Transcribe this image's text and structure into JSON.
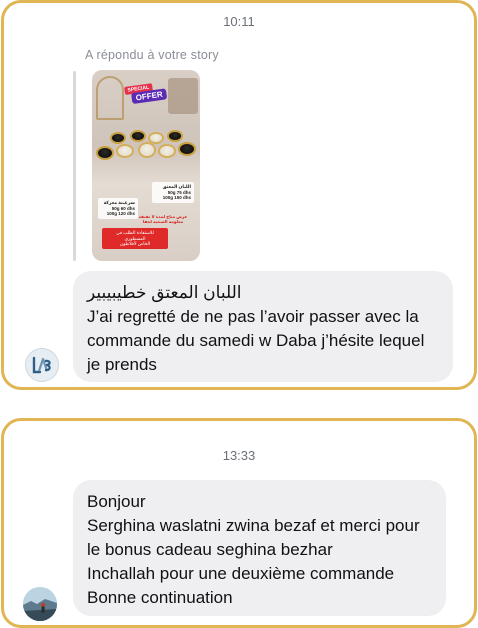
{
  "conversation_1": {
    "timestamp": "10:11",
    "reply_caption": "A répondu à votre story",
    "story": {
      "badge_special": "SPECIAL",
      "badge_offer": "OFFER",
      "label_left": "سرغينة معزكة\n50g 60 dhs\n100g 120 dhs",
      "label_right": "اللبان المعتق\n50g 75 dhs\n100g 150 dhs",
      "label_red_text": "عرض متاح لمدة لا تفتقد\nمعلومة الصحية لحقا",
      "label_red_box": "للاستفادة الطلب في المسطوري\nالخاص لأفلاطون"
    },
    "message": {
      "arabic_line": "اللبان المعتق خطيبيبير",
      "text_line_1": "J’ai regretté de ne pas l’avoir passer avec la",
      "text_line_2": "commande du samedi w Daba j’hésite lequel",
      "text_line_3": "je prends"
    },
    "avatar_icon": "brand-logo-avatar"
  },
  "conversation_2": {
    "timestamp": "13:33",
    "message": {
      "line_1": "Bonjour",
      "line_2": "Serghina waslatni zwina bezaf et merci pour",
      "line_3": "le bonus cadeau seghina bezhar",
      "line_4": "Inchallah pour une deuxième commande",
      "line_5": "Bonne continuation"
    },
    "avatar_icon": "user-photo-avatar"
  },
  "colors": {
    "card_border": "#e0b654",
    "bubble_bg": "#efeff2",
    "timestamp_text": "#6b6f76"
  }
}
